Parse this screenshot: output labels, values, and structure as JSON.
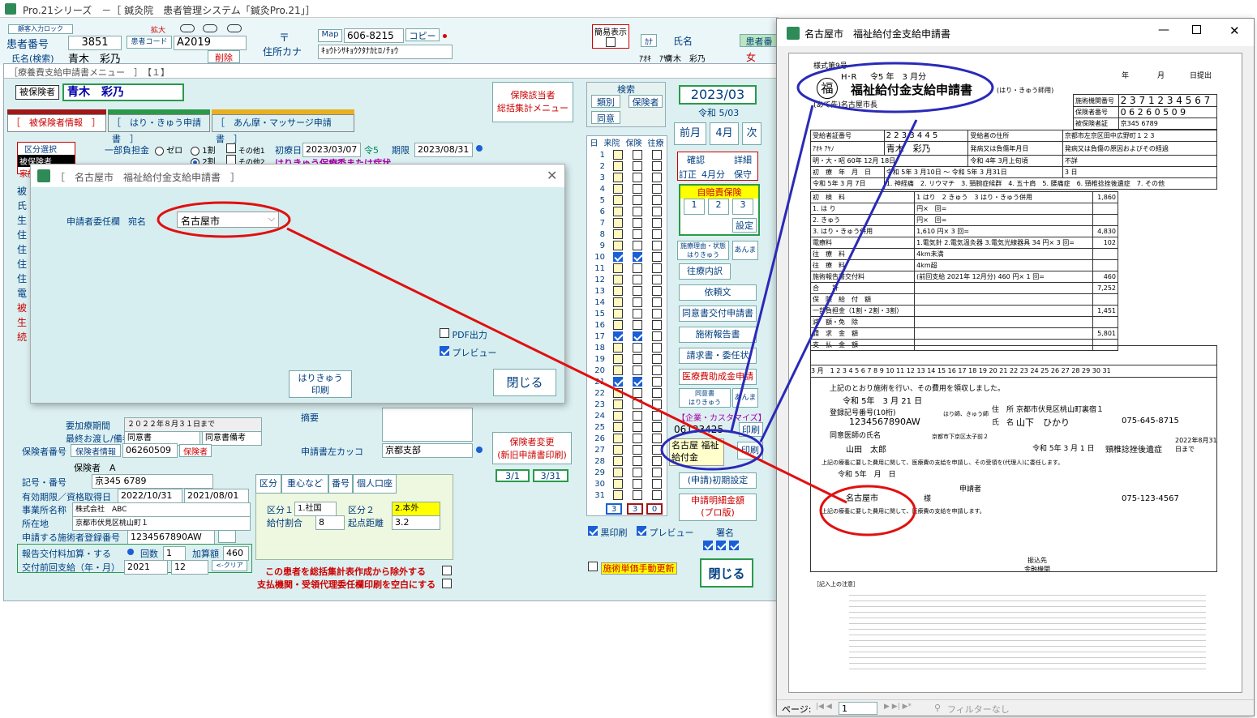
{
  "main_window": {
    "title": "Pro.21シリーズ　－［ 鍼灸院　患者管理システム「鍼灸Pro.21」］",
    "patient_no_label": "患者番号",
    "patient_no": "3851",
    "patient_code_label": "患者コード",
    "patient_code": "A2019",
    "lock_label": "顧客入力ロック",
    "zoom_label": "拡大",
    "name_search_label": "氏名(検索)",
    "name_value": "青木　彩乃",
    "delete_label": "削除",
    "postal_mark": "〒",
    "map_label": "Map",
    "postal": "606-8215",
    "copy_label": "コピー",
    "address_kana_label": "住所カナ",
    "address_kana": "ｷｮｳﾄｼｻｷｮｳｸﾀﾅｶﾋﾛﾉﾁｮｳ",
    "simple_view_label": "簡易表示",
    "kana_tag": "ｶﾅ",
    "name_label": "氏名",
    "patient_no_label2": "患者番",
    "kana_name": "ｱｵｷ　ｱﾔﾉ",
    "name2": "青木　彩乃",
    "gender": "女"
  },
  "menu_window": {
    "title": "［療養費支給申請書メニュー　］　【１】",
    "insured_label": "被保険者",
    "insured_name": "青木　彩乃",
    "insurance_menu": "保険該当者\n総括集計メニュー",
    "tabs": [
      "［　被保険者情報　］",
      "［　はり・きゅう申請書　］",
      "［　あん摩・マッサージ申請書　］"
    ],
    "kubun_label": "区分選択",
    "kubun_items": [
      "被保険者",
      "家族"
    ],
    "copay_label": "一部負担金",
    "copay_opts": [
      "ゼロ",
      "1割",
      "2割",
      "その他1",
      "その他2"
    ],
    "first_visit_label": "初療日",
    "first_visit": "2023/03/07",
    "reiwa5": "令5",
    "period_label": "期限",
    "period": "2023/08/31",
    "consent_label": "はりきゅう保療委または症状",
    "left_labels": [
      "被",
      "氏",
      "生",
      "住",
      "住",
      "住",
      "住",
      "電",
      "被",
      "生",
      "続"
    ],
    "period2_label": "要加療期間",
    "period2_value": "２０２２年８月３１日まで",
    "final_consent_label": "最終お渡し/備考",
    "consent_doc": "同意書",
    "consent_note": "同意書備考",
    "summary_label": "摘要",
    "left_bracket_label": "申請書左カッコ",
    "left_bracket_value": "京都支部",
    "insurer_no_label": "保険者番号",
    "insurer_info": "保険者情報",
    "insurer_no": "06260509",
    "insurer_btn": "保険者",
    "insurer_name": "保険者　A",
    "symbol_label": "記号・番号",
    "symbol": "京345 6789",
    "valid_label": "有効期限／資格取得日",
    "valid_to": "2022/10/31",
    "acquired": "2021/08/01",
    "office_label": "事業所名称",
    "office": "株式会社　ABC",
    "location_label": "所在地",
    "location": "京都市伏見区桃山町１",
    "reg_no_label": "申請する施術者登録番号",
    "reg_no": "1234567890AW",
    "report_label": "報告交付料加算・する",
    "count_label": "回数",
    "count": "1",
    "add_amount_label": "加算額",
    "add_amount": "460",
    "prev_label": "交付前回支給（年・月）",
    "prev_year": "2021",
    "prev_month": "12",
    "clear_label": "<-クリア",
    "sub_tabs": [
      "区分",
      "重心など",
      "番号",
      "個人口座"
    ],
    "kubun1_label": "区分１",
    "kubun1": "1.社国",
    "kubun2_label": "区分２",
    "kubun2": "2.本外",
    "benefit_label": "給付割合",
    "benefit": "8",
    "distance_label": "起点距離",
    "distance": "3.2",
    "exclude_label": "この患者を総括集計表作成から除外する",
    "blank_label": "支払機関・受領代理委任欄印刷を空白にする",
    "change_insurer": "保険者変更\n(新旧申請書印刷)",
    "d31": "3/1",
    "d331": "3/31",
    "search_label": "検索",
    "search_btns": [
      "類別",
      "保険者",
      "同意"
    ],
    "day_head": [
      "日",
      "来院",
      "保険",
      "往療"
    ],
    "counts": [
      "3",
      "3",
      "0"
    ],
    "black_print": "黒印刷",
    "preview": "プレビュー",
    "sign": "署名",
    "update_price": "施術単価手動更新",
    "close": "閉じる",
    "month": "2023/03",
    "reiwa": "令和 5/03",
    "prev_month_btn": "前月",
    "month_btn": "4月",
    "next_btn": "次",
    "confirm": "確認",
    "detail": "詳細",
    "revise": "訂正",
    "apr": "4月分",
    "hold": "保守",
    "jibai": "自賠責保険",
    "nums": [
      "1",
      "2",
      "3"
    ],
    "setting": "設定",
    "reason_btn": "施療理由・状態\nはりきゅう",
    "anma": "あんま",
    "ouryo": "往療内訳",
    "irai": "依頼文",
    "doui_shinsei": "同意書交付申請書",
    "sejutsu_report": "施術報告書",
    "seikyu": "請求書・委任状",
    "iryou": "医療費助成金申請",
    "doui": "同意書\nはりきゅう",
    "anma2": "あんま",
    "company": "【企業・カスタマイズ】",
    "code": "06133425",
    "print": "印刷",
    "nagoya_box": "名古屋 福祉\n給付金",
    "print2": "印刷",
    "shinsei_init": "(申請)初期設定",
    "detail_pro": "申請明細金額\n(プロ版)",
    "close2": "閉じる"
  },
  "dialog": {
    "title": "［　名古屋市　福祉給付金支給申請書　］",
    "delegate_label": "申請者委任欄",
    "addressee_label": "宛名",
    "addressee": "名古屋市",
    "pdf_label": "PDF出力",
    "preview_label": "プレビュー",
    "print_btn": "はりきゅう\n印刷",
    "close_btn": "閉じる"
  },
  "preview_window": {
    "title": "名古屋市　福祉給付金支給申請書",
    "form_no": "様式第9号",
    "hr": "H･R",
    "date_head": "令5 年　3 月分",
    "year": "年",
    "month": "月",
    "day_submit": "日提出",
    "fuku": "福",
    "doc_title": "福祉給付金支給申請書",
    "sub_title": "(はり・きゅう師用)",
    "to": "(あて先)名古屋市長",
    "insurer_no_label": "施術機関番号",
    "insurer_no_digits": "2 3 7 1 2 3 4 5 6 7",
    "insurer_code_label": "保険者番号",
    "insurer_code": "0 6 2 6 0 5 0 9",
    "insured_sym_label": "被保険者証",
    "insured_sym": "京345 6789",
    "recipient_label": "受給者証番号",
    "recipient": "2 2 3 3 4 4 5",
    "furigana": "ｱｵｷ ｱﾔﾉ",
    "patient_name": "青木　彩乃",
    "birth": "明・大・昭 60年 12月 18日",
    "addr_label": "受給者の住所",
    "addr": "京都市左京区田中広野町１２３",
    "onset_label": "発病又は負傷年月日",
    "onset": "令和 4年 3月上旬頃",
    "cause_label": "発病又は負傷の原因およびその経過",
    "cause": "不詳",
    "first_label": "初　療　年　月　日",
    "first": "令和 5年 3 月 7日",
    "term": "令和 5年 3 月10日 ～ 令和 5年 3 月31日",
    "days": "3 日",
    "disease": "1. 神経痛　2. リウマチ　3. 頸腕症候群　4. 五十肩　5. 腰痛症　6. 頸椎捻挫後遺症　7. その他",
    "rows": [
      [
        "初　検　料",
        "1 はり　2 きゅう　3 はり・きゅう併用",
        "1,860"
      ],
      [
        "1. は り",
        "円×　回=",
        ""
      ],
      [
        "2. きゅう",
        "円×　回=",
        ""
      ],
      [
        "3. はり・きゅう併用",
        "1,610 円× 3 回=",
        "4,830"
      ],
      [
        "電療料",
        "1.電気針 2.電気温灸器 3.電気光線器具 34 円× 3 回=",
        "102"
      ],
      [
        "往　療　料",
        "4km未満",
        ""
      ],
      [
        "往　療　料",
        "4km超",
        ""
      ],
      [
        "施術報告書交付料",
        "(前回支給 2021年 12月分) 460 円× 1 回=",
        "460"
      ],
      [
        "合　　計",
        "",
        "7,252"
      ],
      [
        "保　険　給　付　額",
        "",
        ""
      ],
      [
        "一部負担金（1割・2割・3割）",
        "",
        "1,451"
      ],
      [
        "減　額・免　除",
        "",
        ""
      ],
      [
        "請　求　金　額",
        "",
        "5,801"
      ],
      [
        "支　払　金　額",
        "",
        ""
      ]
    ],
    "visit_days": "3 月　1 2 3 4 5 6 7 8 9 10 11 12 13 14 15 16 17 18 19 20 21 22 23 24 25 26 27 28 29 30 31",
    "statement": "上記のとおり施術を行い、その費用を領収しました。",
    "statement_date": "令和 5年　3 月 21 日",
    "reg_label": "登録記号番号(10桁)",
    "reg_value": "1234567890AW",
    "address_label": "住　所",
    "address": "京都市伏見区桃山町裏宿１",
    "clinic": "はり師、きゅう師",
    "practitioner_label": "氏　名",
    "practitioner": "山下　ひかり",
    "tel": "075-645-8715",
    "doctor_label": "同意医師の氏名",
    "doctor": "山田　太郎",
    "hospital": "京都市下京区太子前２",
    "consent_date": "令和 5年 3 月 1 日",
    "diag": "頸椎捻挫後遺症",
    "until": "2022年8月31日まで",
    "apply_text": "上記の療養に要した費用に関して、医療費の支給を申請し、その受領を(代理人)に委任します。",
    "apply_date": "令和 5年　月　日",
    "nagoya": "名古屋市",
    "sama": "様",
    "applicant_label": "申請者",
    "applicant_tel": "075-123-4567",
    "receive_text": "上記の療養に要した費用に関して、医療費の支給を申請します。",
    "bank": "振込先\n金融機関",
    "notes_head": "［記入上の注意］",
    "page_label": "ページ:",
    "page": "1",
    "filter": "フィルターなし"
  }
}
